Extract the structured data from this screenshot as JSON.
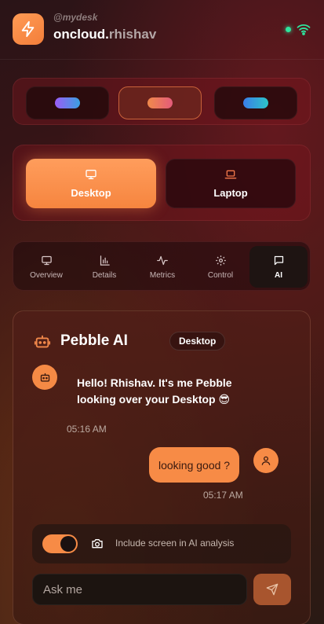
{
  "header": {
    "handle": "@mydesk",
    "brand_prefix": "oncloud.",
    "brand_name": "rhishav",
    "status_color": "#2ee59d",
    "logo_icon": "lightning-bolt-icon",
    "connection_icon": "wifi-icon"
  },
  "theme_presets": [
    {
      "id": "purple-blue",
      "colors": [
        "#9b5cf6",
        "#3aa0e0"
      ],
      "selected": false
    },
    {
      "id": "orange-pink",
      "colors": [
        "#f08a4b",
        "#e45b7a"
      ],
      "selected": true
    },
    {
      "id": "blue-teal",
      "colors": [
        "#3b7de8",
        "#2cc5c9"
      ],
      "selected": false
    }
  ],
  "devices": [
    {
      "label": "Desktop",
      "icon": "monitor-icon",
      "selected": true
    },
    {
      "label": "Laptop",
      "icon": "laptop-icon",
      "selected": false
    }
  ],
  "tabs": [
    {
      "label": "Overview",
      "icon": "monitor-icon",
      "active": false
    },
    {
      "label": "Details",
      "icon": "bar-chart-icon",
      "active": false
    },
    {
      "label": "Metrics",
      "icon": "activity-icon",
      "active": false
    },
    {
      "label": "Control",
      "icon": "gear-icon",
      "active": false
    },
    {
      "label": "AI",
      "icon": "chat-bubble-icon",
      "active": true
    }
  ],
  "ai": {
    "title": "Pebble AI",
    "device_badge": "Desktop",
    "messages": [
      {
        "from": "bot",
        "text": "Hello! Rhishav. It's me Pebble looking over your Desktop 😎",
        "time": "05:16 AM"
      },
      {
        "from": "user",
        "text": "looking good ?",
        "time": "05:17 AM"
      }
    ],
    "share_screen": {
      "enabled": true,
      "label": "Include screen in AI analysis"
    },
    "input_placeholder": "Ask me",
    "accent": "#f78b46"
  }
}
